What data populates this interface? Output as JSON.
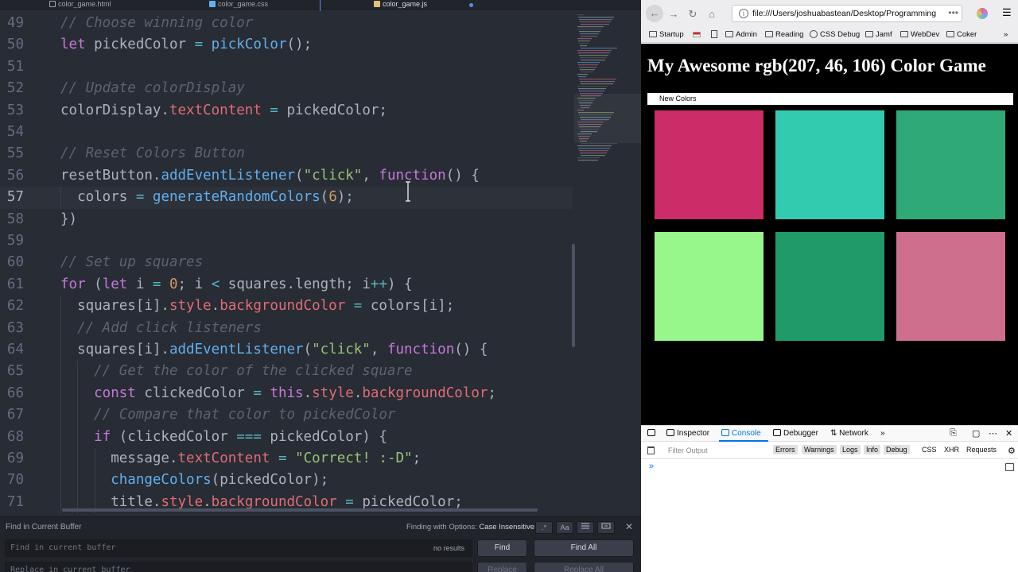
{
  "editor": {
    "tabs": [
      {
        "label": "color_game.html"
      },
      {
        "label": "color_game.css"
      },
      {
        "label": "color_game.js"
      }
    ],
    "lines": [
      {
        "n": "49",
        "t": [
          {
            "c": "c",
            "s": "// Choose winning color"
          }
        ]
      },
      {
        "n": "50",
        "t": [
          {
            "c": "k",
            "s": "let"
          },
          {
            "s": " pickedColor "
          },
          {
            "c": "o",
            "s": "="
          },
          {
            "s": " "
          },
          {
            "c": "f",
            "s": "pickColor"
          },
          {
            "s": "();"
          }
        ]
      },
      {
        "n": "51",
        "t": []
      },
      {
        "n": "52",
        "t": [
          {
            "c": "c",
            "s": "// Update colorDisplay"
          }
        ]
      },
      {
        "n": "53",
        "t": [
          {
            "s": "colorDisplay."
          },
          {
            "c": "p",
            "s": "textContent"
          },
          {
            "s": " "
          },
          {
            "c": "o",
            "s": "="
          },
          {
            "s": " pickedColor;"
          }
        ]
      },
      {
        "n": "54",
        "t": []
      },
      {
        "n": "55",
        "t": [
          {
            "c": "c",
            "s": "// Reset Colors Button"
          }
        ]
      },
      {
        "n": "56",
        "t": [
          {
            "s": "resetButton."
          },
          {
            "c": "f",
            "s": "addEventListener"
          },
          {
            "s": "("
          },
          {
            "c": "s",
            "s": "\"click\""
          },
          {
            "s": ", "
          },
          {
            "c": "k",
            "s": "function"
          },
          {
            "s": "() {"
          }
        ]
      },
      {
        "n": "57",
        "t": [
          {
            "s": "  colors "
          },
          {
            "c": "o",
            "s": "="
          },
          {
            "s": " "
          },
          {
            "c": "f",
            "s": "generateRandomColors"
          },
          {
            "s": "("
          },
          {
            "c": "n",
            "s": "6"
          },
          {
            "s": ");"
          }
        ]
      },
      {
        "n": "58",
        "t": [
          {
            "s": "})"
          }
        ]
      },
      {
        "n": "59",
        "t": []
      },
      {
        "n": "60",
        "t": [
          {
            "c": "c",
            "s": "// Set up squares"
          }
        ]
      },
      {
        "n": "61",
        "t": [
          {
            "c": "k",
            "s": "for"
          },
          {
            "s": " ("
          },
          {
            "c": "k",
            "s": "let"
          },
          {
            "s": " i "
          },
          {
            "c": "o",
            "s": "="
          },
          {
            "s": " "
          },
          {
            "c": "n",
            "s": "0"
          },
          {
            "s": "; i "
          },
          {
            "c": "o",
            "s": "<"
          },
          {
            "s": " squares.length; i"
          },
          {
            "c": "o",
            "s": "++"
          },
          {
            "s": ") {"
          }
        ]
      },
      {
        "n": "62",
        "t": [
          {
            "s": "  squares[i]."
          },
          {
            "c": "p",
            "s": "style"
          },
          {
            "s": "."
          },
          {
            "c": "p",
            "s": "backgroundColor"
          },
          {
            "s": " "
          },
          {
            "c": "o",
            "s": "="
          },
          {
            "s": " colors[i];"
          }
        ]
      },
      {
        "n": "63",
        "t": [
          {
            "c": "c",
            "s": "  // Add click listeners"
          }
        ]
      },
      {
        "n": "64",
        "t": [
          {
            "s": "  squares[i]."
          },
          {
            "c": "f",
            "s": "addEventListener"
          },
          {
            "s": "("
          },
          {
            "c": "s",
            "s": "\"click\""
          },
          {
            "s": ", "
          },
          {
            "c": "k",
            "s": "function"
          },
          {
            "s": "() {"
          }
        ]
      },
      {
        "n": "65",
        "t": [
          {
            "c": "c",
            "s": "    // Get the color of the clicked square"
          }
        ]
      },
      {
        "n": "66",
        "t": [
          {
            "c": "k",
            "s": "    const"
          },
          {
            "s": " clickedColor "
          },
          {
            "c": "o",
            "s": "="
          },
          {
            "s": " "
          },
          {
            "c": "k",
            "s": "this"
          },
          {
            "s": "."
          },
          {
            "c": "p",
            "s": "style"
          },
          {
            "s": "."
          },
          {
            "c": "p",
            "s": "backgroundColor"
          },
          {
            "s": ";"
          }
        ]
      },
      {
        "n": "67",
        "t": [
          {
            "c": "c",
            "s": "    // Compare that color to pickedColor"
          }
        ]
      },
      {
        "n": "68",
        "t": [
          {
            "c": "k",
            "s": "    if"
          },
          {
            "s": " (clickedColor "
          },
          {
            "c": "o",
            "s": "==="
          },
          {
            "s": " pickedColor) {"
          }
        ]
      },
      {
        "n": "69",
        "t": [
          {
            "s": "      message."
          },
          {
            "c": "p",
            "s": "textContent"
          },
          {
            "s": " "
          },
          {
            "c": "o",
            "s": "="
          },
          {
            "s": " "
          },
          {
            "c": "s",
            "s": "\"Correct! :-D\""
          },
          {
            "s": ";"
          }
        ]
      },
      {
        "n": "70",
        "t": [
          {
            "c": "f",
            "s": "      changeColors"
          },
          {
            "s": "(pickedColor);"
          }
        ]
      },
      {
        "n": "71",
        "t": [
          {
            "s": "      title."
          },
          {
            "c": "p",
            "s": "style"
          },
          {
            "s": "."
          },
          {
            "c": "p",
            "s": "backgroundColor"
          },
          {
            "s": " "
          },
          {
            "c": "o",
            "s": "="
          },
          {
            "s": " pickedColor;"
          }
        ]
      }
    ],
    "cursor_line": "57",
    "colors": {
      "background": "#282c34",
      "comment": "#5c6370",
      "keyword": "#c678dd",
      "function": "#61afef",
      "property": "#e06c75",
      "string": "#98c379",
      "number": "#d19a66"
    }
  },
  "find": {
    "title": "Find in Current Buffer",
    "options_label": "Finding with Options:",
    "options_value": "Case Insensitive",
    "regex_label": ".*",
    "case_label": "Aa",
    "find_placeholder": "Find in current buffer",
    "replace_placeholder": "Replace in current buffer",
    "count": "no results",
    "find_button": "Find",
    "find_all_button": "Find All",
    "replace_button": "Replace",
    "replace_all_button": "Replace All"
  },
  "browser": {
    "url": "file:///Users/joshuabastean/Desktop/Programming",
    "url_more": "•••",
    "bookmarks": [
      "Startup",
      "Admin",
      "Reading",
      "CSS Debug",
      "Jamf",
      "WebDev",
      "Coker"
    ],
    "page": {
      "title": "My Awesome rgb(207, 46, 106) Color Game",
      "button": "New Colors",
      "squares": [
        "#cc2c68",
        "#33cbb0",
        "#2faa77",
        "#98f78b",
        "#1f9a68",
        "#ce6f8d"
      ]
    },
    "devtools": {
      "tabs": [
        "Inspector",
        "Console",
        "Debugger",
        "Network"
      ],
      "active_tab": "Console",
      "filter_placeholder": "Filter Output",
      "filters": [
        "Errors",
        "Warnings",
        "Logs",
        "Info",
        "Debug",
        "CSS",
        "XHR",
        "Requests"
      ],
      "prompt": "»"
    }
  }
}
